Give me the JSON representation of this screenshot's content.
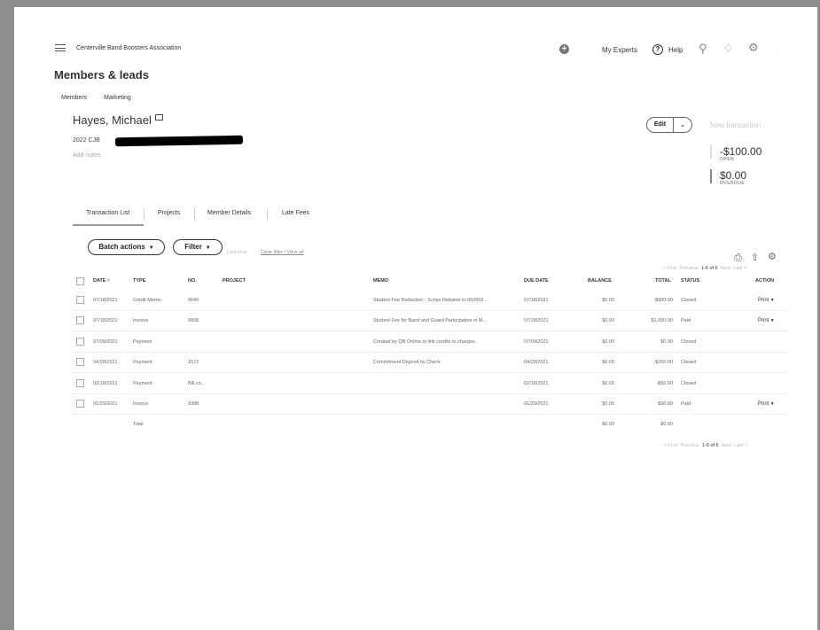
{
  "topbar": {
    "org_name": "Centerville Band Boosters Association",
    "my_experts": "My Experts",
    "help": "Help"
  },
  "page": {
    "title": "Members & leads",
    "subnav": [
      "Members",
      "Marketing"
    ]
  },
  "member": {
    "name": "Hayes, Michael",
    "code": "2022 CJB",
    "add_notes": "Add notes"
  },
  "actions": {
    "edit": "Edit",
    "new_transaction": "New transaction"
  },
  "summary": {
    "open_amount": "-$100.00",
    "open_label": "OPEN",
    "overdue_amount": "$0.00",
    "overdue_label": "OVERDUE"
  },
  "tabs": [
    "Transaction List",
    "Projects",
    "Member Details",
    "Late Fees"
  ],
  "toolbar": {
    "batch_actions": "Batch actions",
    "filter": "Filter",
    "last_year": "Last year",
    "clear_filter": "Clear filter / View all"
  },
  "pagination": {
    "first": "< First",
    "previous": "Previous",
    "range": "1-6 of 6",
    "next": "Next",
    "last": "Last >"
  },
  "table": {
    "headers": {
      "date": "DATE",
      "type": "TYPE",
      "no": "NO.",
      "project": "PROJECT",
      "memo": "MEMO",
      "due_date": "DUE DATE",
      "balance": "BALANCE",
      "total": "TOTAL",
      "status": "STATUS",
      "action": "ACTION"
    },
    "rows": [
      {
        "date": "07/18/2021",
        "type": "Credit Memo",
        "no": "9649",
        "memo": "Student Fee Reduction - Scrips Rebates to 06/30/2...",
        "due_date": "07/18/2021",
        "balance": "$0.00",
        "total": "-$800.00",
        "status": "Closed",
        "action": "Print"
      },
      {
        "date": "07/18/2021",
        "type": "Invoice",
        "no": "9508",
        "memo": "Student Fee for Band and Guard Participation in M...",
        "due_date": "07/18/2021",
        "balance": "$0.00",
        "total": "$1,000.00",
        "status": "Paid",
        "action": "Print"
      },
      {
        "date": "07/09/2021",
        "type": "Payment",
        "no": "",
        "memo": "Created by QB Online to link credits to charges.",
        "due_date": "07/09/2021",
        "balance": "$0.00",
        "total": "$0.00",
        "status": "Closed",
        "action": ""
      },
      {
        "date": "04/28/2021",
        "type": "Payment",
        "no": "1572",
        "memo": "Commitment Deposit by Check",
        "due_date": "04/28/2021",
        "balance": "$0.00",
        "total": "-$200.00",
        "status": "Closed",
        "action": ""
      },
      {
        "date": "02/18/2021",
        "type": "Payment",
        "no": "Bill.co...",
        "memo": "",
        "due_date": "02/18/2021",
        "balance": "$0.00",
        "total": "-$50.00",
        "status": "Closed",
        "action": ""
      },
      {
        "date": "01/29/2021",
        "type": "Invoice",
        "no": "9388",
        "memo": "",
        "due_date": "01/29/2021",
        "balance": "$0.00",
        "total": "$50.00",
        "status": "Paid",
        "action": "Print"
      }
    ],
    "total_row": {
      "label": "Total",
      "balance": "$0.00",
      "total": "$0.00"
    }
  }
}
